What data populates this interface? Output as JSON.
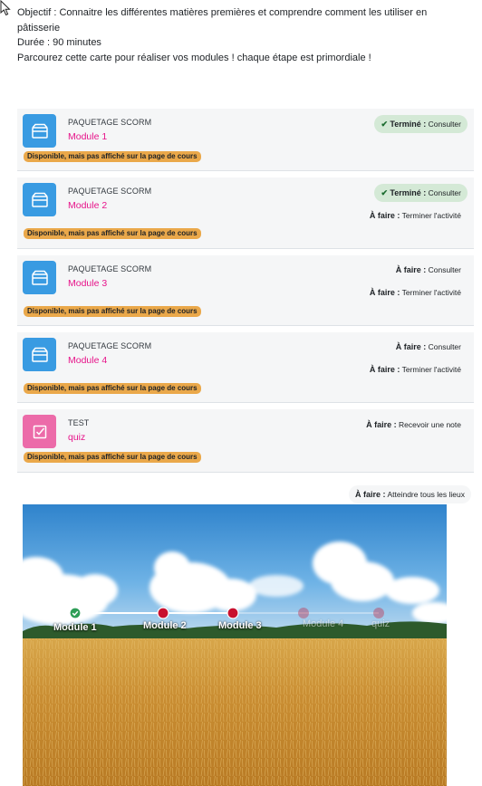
{
  "intro": {
    "objective": "Objectif : Connaitre les différentes matières premières et comprendre comment les utiliser en pâtisserie",
    "duration": "Durée : 90 minutes",
    "instruction": "Parcourez cette carte pour réaliser vos modules ! chaque étape est primordiale !"
  },
  "availability_badge": "Disponible, mais pas affiché sur la page de cours",
  "activities": [
    {
      "type": "PAQUETAGE SCORM",
      "name": "Module 1",
      "icon": "package-icon",
      "completion": [
        {
          "state": "done",
          "label": "Terminé :",
          "action": "Consulter"
        }
      ]
    },
    {
      "type": "PAQUETAGE SCORM",
      "name": "Module 2",
      "icon": "package-icon",
      "completion": [
        {
          "state": "done",
          "label": "Terminé :",
          "action": "Consulter"
        },
        {
          "state": "todo",
          "label": "À faire :",
          "action": "Terminer l'activité"
        }
      ]
    },
    {
      "type": "PAQUETAGE SCORM",
      "name": "Module 3",
      "icon": "package-icon",
      "completion": [
        {
          "state": "todo",
          "label": "À faire :",
          "action": "Consulter"
        },
        {
          "state": "todo",
          "label": "À faire :",
          "action": "Terminer l'activité"
        }
      ]
    },
    {
      "type": "PAQUETAGE SCORM",
      "name": "Module 4",
      "icon": "package-icon",
      "completion": [
        {
          "state": "todo",
          "label": "À faire :",
          "action": "Consulter"
        },
        {
          "state": "todo",
          "label": "À faire :",
          "action": "Terminer l'activité"
        }
      ]
    },
    {
      "type": "TEST",
      "name": "quiz",
      "icon": "checkbox-icon",
      "completion": [
        {
          "state": "todo",
          "label": "À faire :",
          "action": "Recevoir une note"
        }
      ]
    }
  ],
  "map": {
    "status": {
      "label": "À faire :",
      "action": "Atteindre tous les lieux"
    },
    "stops": [
      {
        "label": "Module 1",
        "state": "completed"
      },
      {
        "label": "Module 2",
        "state": "available"
      },
      {
        "label": "Module 3",
        "state": "available"
      },
      {
        "label": "Module 4",
        "state": "locked"
      },
      {
        "label": "quiz",
        "state": "locked"
      }
    ]
  },
  "colors": {
    "link": "#e7148a",
    "scorm_icon_bg": "#399be2",
    "quiz_icon_bg": "#ec6ba9",
    "availability_badge": "#eaa84a",
    "done_badge": "#d4e9d6",
    "stop_completed": "#2e9e57",
    "stop_available": "#c8102e"
  }
}
